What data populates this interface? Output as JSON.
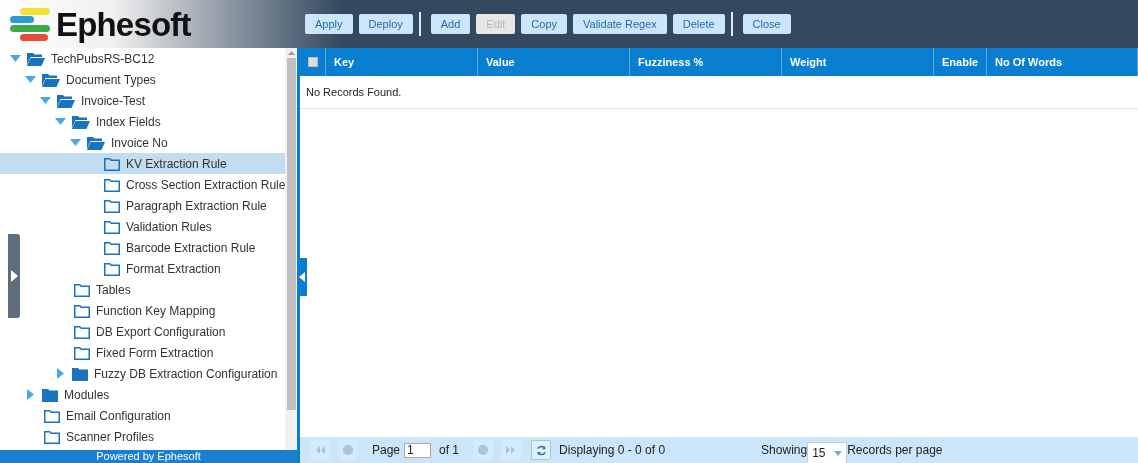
{
  "logo": {
    "text": "Ephesoft"
  },
  "toolbar": {
    "groups": [
      [
        {
          "label": "Apply",
          "disabled": false
        },
        {
          "label": "Deploy",
          "disabled": false
        }
      ],
      [
        {
          "label": "Add",
          "disabled": false
        },
        {
          "label": "Edit",
          "disabled": true
        },
        {
          "label": "Copy",
          "disabled": false
        },
        {
          "label": "Validate Regex",
          "disabled": false
        },
        {
          "label": "Delete",
          "disabled": false
        }
      ],
      [
        {
          "label": "Close",
          "disabled": false
        }
      ]
    ]
  },
  "tree": [
    {
      "label": "TechPubsRS-BC12",
      "kind": "branch",
      "expanded": true,
      "selected": false,
      "children": [
        {
          "label": "Document Types",
          "kind": "branch",
          "expanded": true,
          "selected": false,
          "children": [
            {
              "label": "Invoice-Test",
              "kind": "branch",
              "expanded": true,
              "selected": false,
              "children": [
                {
                  "label": "Index Fields",
                  "kind": "branch",
                  "expanded": true,
                  "selected": false,
                  "children": [
                    {
                      "label": "Invoice No",
                      "kind": "branch",
                      "expanded": true,
                      "selected": false,
                      "children": [
                        {
                          "label": "KV Extraction Rule",
                          "kind": "leaf",
                          "selected": true
                        },
                        {
                          "label": "Cross Section Extraction Rule",
                          "kind": "leaf",
                          "selected": false
                        },
                        {
                          "label": "Paragraph Extraction Rule",
                          "kind": "leaf",
                          "selected": false
                        },
                        {
                          "label": "Validation Rules",
                          "kind": "leaf",
                          "selected": false
                        },
                        {
                          "label": "Barcode Extraction Rule",
                          "kind": "leaf",
                          "selected": false
                        },
                        {
                          "label": "Format Extraction",
                          "kind": "leaf",
                          "selected": false
                        }
                      ]
                    }
                  ]
                },
                {
                  "label": "Tables",
                  "kind": "leaf",
                  "selected": false
                },
                {
                  "label": "Function Key Mapping",
                  "kind": "leaf",
                  "selected": false
                },
                {
                  "label": "DB Export Configuration",
                  "kind": "leaf",
                  "selected": false
                },
                {
                  "label": "Fixed Form Extraction",
                  "kind": "leaf",
                  "selected": false
                },
                {
                  "label": "Fuzzy DB Extraction Configuration",
                  "kind": "branch",
                  "expanded": false,
                  "selected": false
                }
              ]
            }
          ]
        },
        {
          "label": "Modules",
          "kind": "branch",
          "expanded": false,
          "selected": false
        },
        {
          "label": "Email Configuration",
          "kind": "leaf",
          "selected": false
        },
        {
          "label": "Scanner Profiles",
          "kind": "leaf",
          "selected": false
        }
      ]
    }
  ],
  "sidebar_footer": "Powered by Ephesoft",
  "table": {
    "select_all_checked": false,
    "columns": [
      "Key",
      "Value",
      "Fuzziness %",
      "Weight",
      "Enable",
      "No Of Words"
    ],
    "empty_message": "No Records Found."
  },
  "pager": {
    "page_label": "Page",
    "page": "1",
    "of": "of 1",
    "displaying": "Displaying 0 - 0 of 0",
    "showing": "Showing",
    "per_page": "15",
    "records_per_page": "Records per page"
  }
}
